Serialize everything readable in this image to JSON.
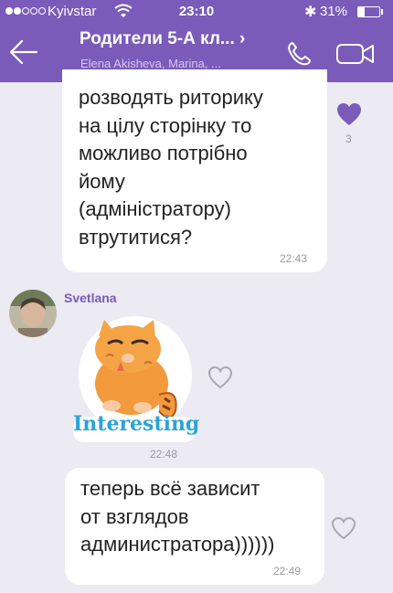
{
  "status_bar": {
    "carrier": "Kyivstar",
    "time": "23:10",
    "battery": "31%",
    "battery_level": 0.31
  },
  "header": {
    "title": "Родители 5-А кл... ›",
    "subtitle": "Elena Akisheva, Marina, ..."
  },
  "messages": [
    {
      "lines": [
        "розводять риторику",
        "на цілу сторінку то",
        "можливо потрібно",
        "йому",
        "(адміністратору)",
        "втрутитися?"
      ],
      "time": "22:43",
      "likes": "3"
    },
    {
      "sender": "Svetlana",
      "sticker_text": "Interesting",
      "time": "22:48"
    },
    {
      "lines": [
        "теперь всё зависит",
        "от взглядов",
        "администратора))))))"
      ],
      "time": "22:49"
    }
  ],
  "colors": {
    "brand": "#7a5bb9",
    "background": "#eceaf2",
    "bubble": "#ffffff"
  },
  "icons": {
    "back": "back-arrow-icon",
    "call": "phone-icon",
    "video": "video-camera-icon",
    "like": "heart-icon"
  }
}
